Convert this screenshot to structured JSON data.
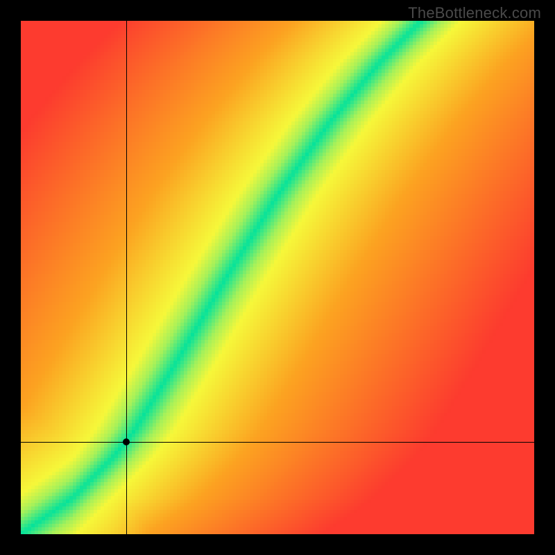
{
  "watermark": "TheBottleneck.com",
  "chart_data": {
    "type": "heatmap",
    "title": "",
    "xlabel": "",
    "ylabel": "",
    "description": "Bottleneck compatibility heatmap. Background is a red→orange→yellow gradient; a diagonal green band marks the optimal pairing corridor. A black dot with crosshairs marks the user's selected configuration.",
    "axes": {
      "x_range": [
        0,
        1
      ],
      "y_range": [
        0,
        1
      ],
      "grid": false,
      "ticks": "none visible"
    },
    "marker": {
      "x": 0.205,
      "y": 0.18,
      "note": "selected configuration (fraction of axis, origin bottom-left)"
    },
    "green_band": {
      "note": "approximate centerline of the green optimal band, origin bottom-left, normalized 0..1",
      "points": [
        {
          "x": 0.0,
          "y": 0.0
        },
        {
          "x": 0.1,
          "y": 0.07
        },
        {
          "x": 0.18,
          "y": 0.15
        },
        {
          "x": 0.22,
          "y": 0.2
        },
        {
          "x": 0.3,
          "y": 0.33
        },
        {
          "x": 0.4,
          "y": 0.5
        },
        {
          "x": 0.5,
          "y": 0.66
        },
        {
          "x": 0.6,
          "y": 0.8
        },
        {
          "x": 0.7,
          "y": 0.92
        },
        {
          "x": 0.78,
          "y": 1.0
        }
      ],
      "band_halfwidth": 0.04
    },
    "palette": {
      "best": "#06e39b",
      "good": "#f6f83a",
      "mid": "#fca321",
      "poor": "#fd3b2f"
    }
  }
}
